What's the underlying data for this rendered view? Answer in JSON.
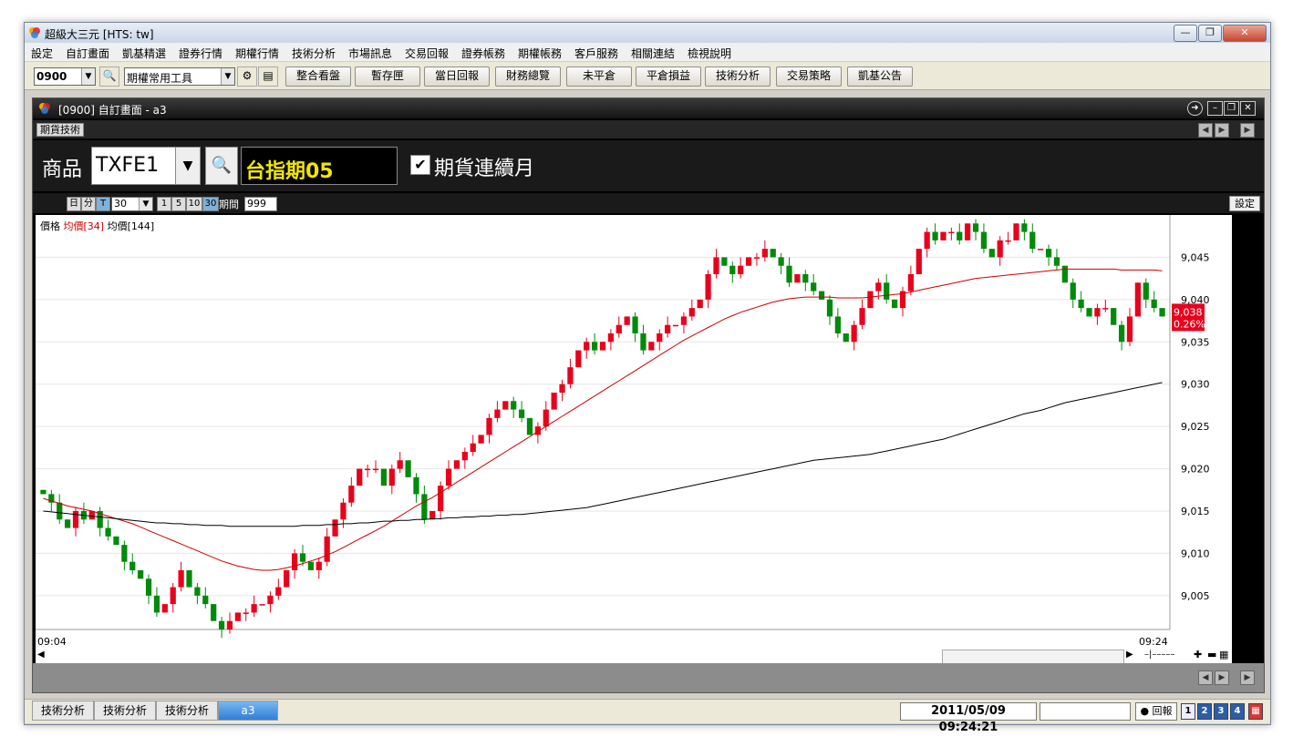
{
  "window": {
    "title": "超級大三元  [HTS: tw]"
  },
  "menu": [
    "設定",
    "自訂畫面",
    "凱基精選",
    "證券行情",
    "期權行情",
    "技術分析",
    "市場訊息",
    "交易回報",
    "證券帳務",
    "期權帳務",
    "客戶服務",
    "相關連結",
    "檢視說明"
  ],
  "toolbar": {
    "code": "0900",
    "tools_select": "期權常用工具",
    "buttons": [
      "整合看盤",
      "暫存匣",
      "當日回報",
      "財務總覽",
      "未平倉",
      "平倉損益",
      "技術分析",
      "交易策略",
      "凱基公告"
    ]
  },
  "subwindow": {
    "title": "[0900] 自訂畫面 - a3",
    "tab": "期貨技術"
  },
  "product": {
    "label": "商品",
    "symbol": "TXFE1",
    "name": "台指期05",
    "continuous_label": "期貨連續月",
    "continuous_checked": true
  },
  "period": {
    "buttons": [
      "日",
      "分",
      "T"
    ],
    "interval": "30",
    "minute_buttons": [
      "1",
      "5",
      "10",
      "30"
    ],
    "range_label": "期間",
    "range_value": "999",
    "settings_label": "設定"
  },
  "legend": {
    "price": "價格",
    "ma34": "均價[34]",
    "ma144": "均價[144]"
  },
  "colors": {
    "up": "#e8001c",
    "down": "#008a0a",
    "ma34": "#cc0000",
    "ma144": "#000000"
  },
  "chart_data": {
    "type": "candlestick",
    "x_start_label": "09:04",
    "x_end_label": "09:24",
    "ylim": [
      9001,
      9050
    ],
    "yticks": [
      9005,
      9010,
      9015,
      9020,
      9025,
      9030,
      9035,
      9040,
      9045
    ],
    "ytick_labels": [
      "9,005",
      "9,010",
      "9,015",
      "9,020",
      "9,025",
      "9,030",
      "9,035",
      "9,040",
      "9,045"
    ],
    "last_price": "9,038",
    "last_change": "0.26%",
    "closes": [
      9017,
      9016,
      9014,
      9013,
      9015,
      9014,
      9015,
      9013,
      9012,
      9011,
      9009,
      9008,
      9007,
      9005,
      9003,
      9004,
      9006,
      9008,
      9006,
      9005,
      9004,
      9002,
      9001,
      9002,
      9003,
      9003,
      9004,
      9004,
      9005,
      9006,
      9008,
      9010,
      9009,
      9008,
      9009,
      9012,
      9014,
      9016,
      9018,
      9020,
      9020,
      9020,
      9018,
      9020,
      9021,
      9019,
      9017,
      9014,
      9015,
      9018,
      9020,
      9021,
      9022,
      9023,
      9024,
      9026,
      9027,
      9028,
      9027,
      9026,
      9024,
      9025,
      9027,
      9029,
      9030,
      9032,
      9034,
      9035,
      9034,
      9035,
      9036,
      9037,
      9038,
      9036,
      9034,
      9035,
      9036,
      9037,
      9037,
      9038,
      9039,
      9040,
      9043,
      9045,
      9044,
      9043,
      9044,
      9045,
      9045,
      9046,
      9045,
      9044,
      9042,
      9043,
      9042,
      9041,
      9040,
      9038,
      9036,
      9035,
      9037,
      9039,
      9041,
      9042,
      9040,
      9039,
      9041,
      9043,
      9046,
      9048,
      9047,
      9048,
      9048,
      9047,
      9049,
      9048,
      9046,
      9045,
      9047,
      9047,
      9049,
      9048,
      9046,
      9046,
      9045,
      9044,
      9042,
      9040,
      9039,
      9038,
      9039,
      9039,
      9037,
      9035,
      9038,
      9042,
      9040,
      9039,
      9038
    ],
    "ma34": [
      9016.5,
      9016.2,
      9015.9,
      9015.6,
      9015.4,
      9015.2,
      9015.0,
      9014.7,
      9014.4,
      9014.1,
      9013.8,
      9013.5,
      9013.1,
      9012.7,
      9012.3,
      9011.9,
      9011.5,
      9011.1,
      9010.7,
      9010.3,
      9009.9,
      9009.5,
      9009.1,
      9008.8,
      9008.5,
      9008.3,
      9008.1,
      9008.0,
      9008.0,
      9008.1,
      9008.3,
      9008.5,
      9008.8,
      9009.1,
      9009.4,
      9009.8,
      9010.2,
      9010.7,
      9011.2,
      9011.7,
      9012.2,
      9012.7,
      9013.2,
      9013.8,
      9014.4,
      9015.0,
      9015.6,
      9016.1,
      9016.6,
      9017.2,
      9017.8,
      9018.4,
      9019.0,
      9019.6,
      9020.2,
      9020.8,
      9021.4,
      9022.0,
      9022.6,
      9023.2,
      9023.8,
      9024.4,
      9025.0,
      9025.6,
      9026.2,
      9026.8,
      9027.4,
      9028.0,
      9028.6,
      9029.2,
      9029.8,
      9030.4,
      9031.0,
      9031.6,
      9032.2,
      9032.8,
      9033.4,
      9034.0,
      9034.6,
      9035.2,
      9035.7,
      9036.2,
      9036.7,
      9037.2,
      9037.7,
      9038.1,
      9038.5,
      9038.8,
      9039.1,
      9039.4,
      9039.7,
      9039.9,
      9040.1,
      9040.2,
      9040.3,
      9040.3,
      9040.3,
      9040.3,
      9040.2,
      9040.2,
      9040.2,
      9040.2,
      9040.3,
      9040.4,
      9040.5,
      9040.6,
      9040.7,
      9040.9,
      9041.1,
      9041.3,
      9041.5,
      9041.7,
      9041.9,
      9042.1,
      9042.3,
      9042.5,
      9042.6,
      9042.7,
      9042.8,
      9042.9,
      9043.0,
      9043.1,
      9043.2,
      9043.3,
      9043.4,
      9043.5,
      9043.6,
      9043.6,
      9043.6,
      9043.6,
      9043.6,
      9043.6,
      9043.6,
      9043.5,
      9043.5,
      9043.5,
      9043.5,
      9043.5,
      9043.4
    ],
    "ma144": [
      9015.0,
      9014.9,
      9014.8,
      9014.7,
      9014.6,
      9014.5,
      9014.4,
      9014.3,
      9014.2,
      9014.1,
      9014.0,
      9013.9,
      9013.8,
      9013.7,
      9013.6,
      9013.6,
      9013.5,
      9013.5,
      9013.4,
      9013.4,
      9013.3,
      9013.3,
      9013.3,
      9013.2,
      9013.2,
      9013.2,
      9013.2,
      9013.2,
      9013.2,
      9013.2,
      9013.2,
      9013.2,
      9013.3,
      9013.3,
      9013.3,
      9013.4,
      9013.4,
      9013.5,
      9013.5,
      9013.6,
      9013.6,
      9013.7,
      9013.8,
      9013.8,
      9013.9,
      9013.9,
      9014.0,
      9014.0,
      9014.1,
      9014.1,
      9014.2,
      9014.2,
      9014.3,
      9014.3,
      9014.4,
      9014.4,
      9014.5,
      9014.5,
      9014.6,
      9014.6,
      9014.7,
      9014.8,
      9014.9,
      9015.0,
      9015.1,
      9015.2,
      9015.3,
      9015.4,
      9015.6,
      9015.8,
      9016.0,
      9016.2,
      9016.4,
      9016.6,
      9016.8,
      9017.0,
      9017.2,
      9017.4,
      9017.6,
      9017.8,
      9018.0,
      9018.2,
      9018.4,
      9018.6,
      9018.8,
      9019.0,
      9019.2,
      9019.4,
      9019.6,
      9019.8,
      9020.0,
      9020.2,
      9020.4,
      9020.6,
      9020.8,
      9021.0,
      9021.1,
      9021.2,
      9021.3,
      9021.4,
      9021.5,
      9021.6,
      9021.7,
      9021.9,
      9022.1,
      9022.3,
      9022.5,
      9022.7,
      9022.9,
      9023.1,
      9023.3,
      9023.5,
      9023.8,
      9024.1,
      9024.4,
      9024.7,
      9025.0,
      9025.3,
      9025.6,
      9025.9,
      9026.2,
      9026.5,
      9026.7,
      9026.9,
      9027.2,
      9027.5,
      9027.8,
      9028.0,
      9028.2,
      9028.4,
      9028.6,
      9028.8,
      9029.0,
      9029.2,
      9029.4,
      9029.6,
      9029.8,
      9030.0,
      9030.2
    ]
  },
  "status": {
    "tabs": [
      "技術分析",
      "技術分析",
      "技術分析",
      "a3"
    ],
    "datetime": "2011/05/09 09:24:21",
    "report_label": "回報",
    "nums": [
      "1",
      "2",
      "3",
      "4"
    ]
  }
}
